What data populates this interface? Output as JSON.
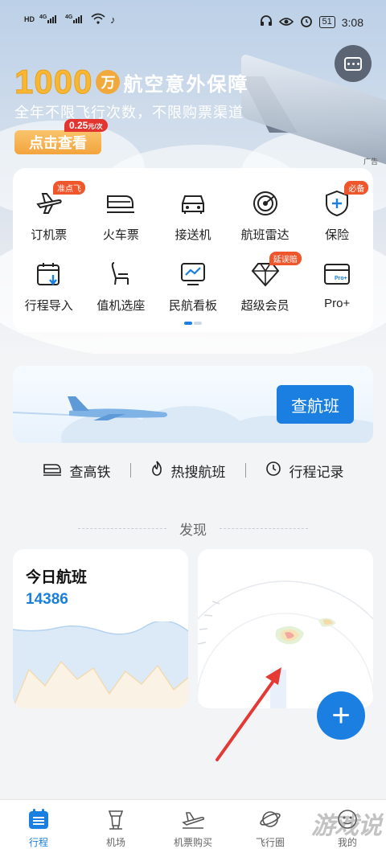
{
  "status_bar": {
    "left_icons": [
      "HD",
      "4G",
      "4G",
      "wifi",
      "music"
    ],
    "battery": "51",
    "time": "3:08",
    "right_icons": [
      "headphones-icon",
      "eye-icon",
      "alarm-icon"
    ]
  },
  "ad": {
    "headline_number": "1000",
    "headline_unit": "万",
    "headline_text": "航空意外保障",
    "subtitle": "全年不限飞行次数，不限购票渠道",
    "cta": "点击查看",
    "price": "0.25",
    "price_unit": "元/次",
    "tag": "广告"
  },
  "services": [
    {
      "label": "订机票",
      "icon": "plane-icon",
      "badge": "准点飞"
    },
    {
      "label": "火车票",
      "icon": "train-icon",
      "badge": ""
    },
    {
      "label": "接送机",
      "icon": "car-icon",
      "badge": ""
    },
    {
      "label": "航班雷达",
      "icon": "radar-icon",
      "badge": ""
    },
    {
      "label": "保险",
      "icon": "shield-plus-icon",
      "badge": "必备"
    },
    {
      "label": "行程导入",
      "icon": "calendar-import-icon",
      "badge": ""
    },
    {
      "label": "值机选座",
      "icon": "seat-icon",
      "badge": ""
    },
    {
      "label": "民航看板",
      "icon": "dashboard-icon",
      "badge": ""
    },
    {
      "label": "超级会员",
      "icon": "diamond-icon",
      "badge": "延误赔"
    },
    {
      "label": "Pro+",
      "icon": "pro-card-icon",
      "badge": ""
    }
  ],
  "flight_banner": {
    "button": "查航班"
  },
  "quick_links": [
    {
      "label": "查高铁",
      "icon": "train-front-icon"
    },
    {
      "label": "热搜航班",
      "icon": "flame-icon"
    },
    {
      "label": "行程记录",
      "icon": "clock-icon"
    }
  ],
  "discover": {
    "title": "发现"
  },
  "today_flights": {
    "title": "今日航班",
    "count": "14386"
  },
  "fab": "+",
  "tabs": [
    {
      "label": "行程",
      "icon": "itinerary-icon",
      "active": true
    },
    {
      "label": "机场",
      "icon": "airport-tower-icon",
      "active": false
    },
    {
      "label": "机票购买",
      "icon": "plane-takeoff-icon",
      "active": false
    },
    {
      "label": "飞行圈",
      "icon": "planet-icon",
      "active": false
    },
    {
      "label": "我的",
      "icon": "user-icon",
      "active": false
    }
  ],
  "watermark": "游戏说",
  "colors": {
    "primary": "#1a7fe0",
    "badge": "#f0562b",
    "ad_gold": "#f7b733"
  }
}
